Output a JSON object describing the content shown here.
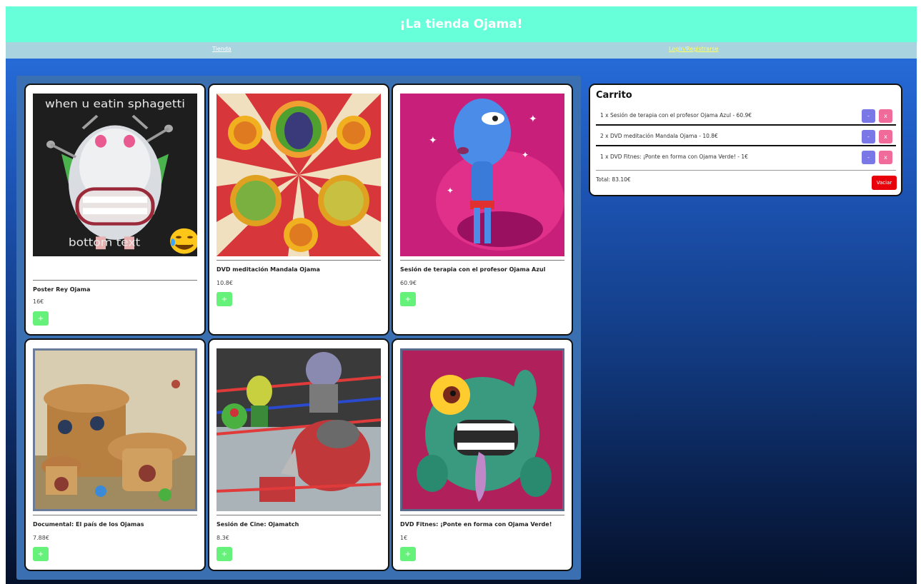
{
  "header": {
    "title": "¡La tienda Ojama!"
  },
  "nav": {
    "shop_link": "Tienda",
    "login_link": "Login/Registrarse"
  },
  "products": [
    {
      "name": "Poster Rey Ojama",
      "price": "16€",
      "add_label": "+",
      "meme_top": "when u eatin sphagetti",
      "meme_bottom": "bottom text",
      "image_icon": "king-ojama-meme-image"
    },
    {
      "name": "DVD meditación Mandala Ojama",
      "price": "10.8€",
      "add_label": "+",
      "image_icon": "mandala-ojama-image"
    },
    {
      "name": "Sesión de terapia con el profesor Ojama Azul",
      "price": "60.9€",
      "add_label": "+",
      "image_icon": "ojama-blue-image"
    },
    {
      "name": "Documental: El país de los Ojamas",
      "price": "7.88€",
      "add_label": "+",
      "image_icon": "ojama-country-image"
    },
    {
      "name": "Sesión de Cine: Ojamatch",
      "price": "8.3€",
      "add_label": "+",
      "image_icon": "ojamatch-image"
    },
    {
      "name": "DVD Fitnes: ¡Ponte en forma con Ojama Verde!",
      "price": "1€",
      "add_label": "+",
      "image_icon": "ojama-green-image"
    }
  ],
  "cart": {
    "title": "Carrito",
    "items": [
      {
        "text": "1 x Sesión de terapia con el profesor Ojama Azul - 60.9€",
        "minus_label": "-",
        "remove_label": "x"
      },
      {
        "text": "2 x DVD meditación Mandala Ojama - 10.8€",
        "minus_label": "-",
        "remove_label": "x"
      },
      {
        "text": "1 x DVD Fitnes: ¡Ponte en forma con Ojama Verde! - 1€",
        "minus_label": "-",
        "remove_label": "x"
      }
    ],
    "total": "Total: 83.10€",
    "clear_label": "Vaciar"
  },
  "colors": {
    "header_bg": "#66ffd9",
    "nav_bg": "#a9d3de",
    "add_button": "#66f27a",
    "minus_button": "#7a78e6",
    "remove_button": "#f06a9a",
    "clear_button": "#e8000a"
  }
}
